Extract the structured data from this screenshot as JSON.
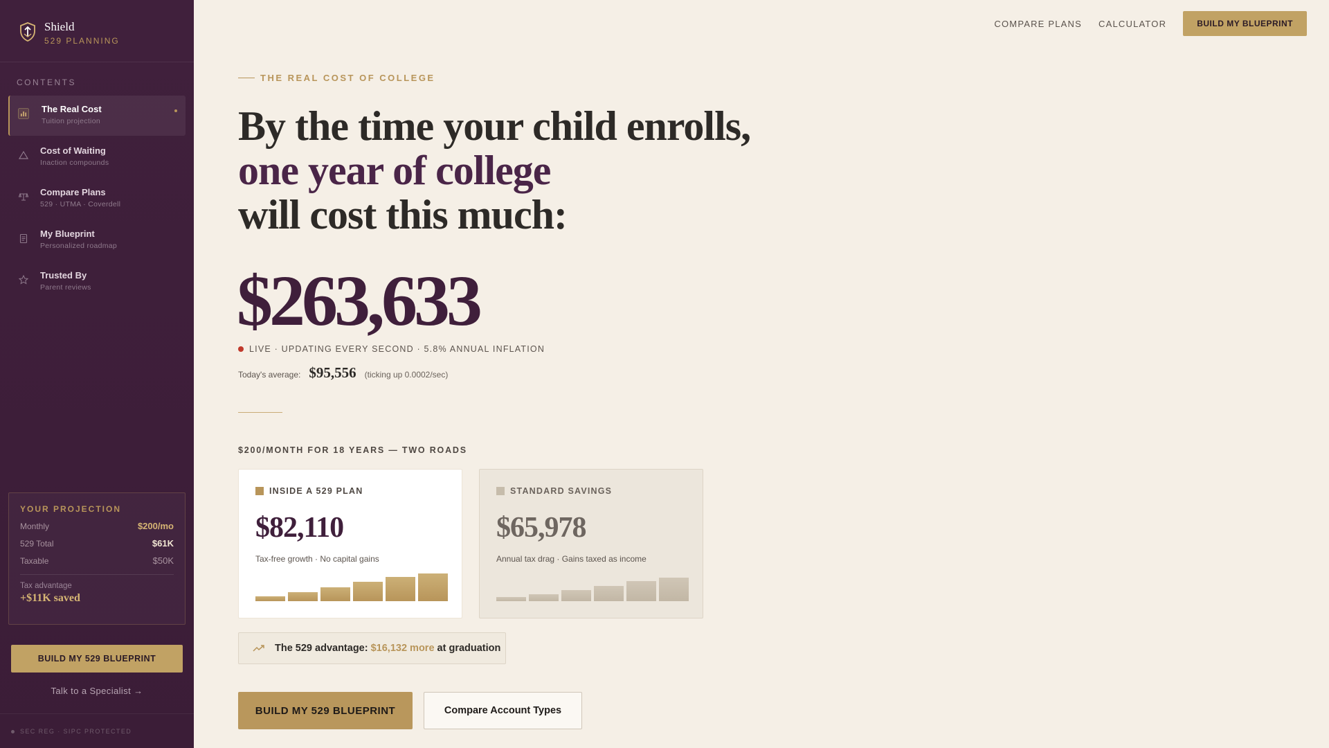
{
  "brand": {
    "name": "Shield",
    "subtitle": "529 PLANNING",
    "icon": "shield-icon"
  },
  "sidebar": {
    "contents_label": "CONTENTS",
    "items": [
      {
        "title": "The Real Cost",
        "subtitle": "Tuition projection",
        "icon": "bar-chart-icon",
        "active": true
      },
      {
        "title": "Cost of Waiting",
        "subtitle": "Inaction compounds",
        "icon": "warning-icon",
        "active": false
      },
      {
        "title": "Compare Plans",
        "subtitle": "529 · UTMA · Coverdell",
        "icon": "scale-icon",
        "active": false
      },
      {
        "title": "My Blueprint",
        "subtitle": "Personalized roadmap",
        "icon": "clipboard-icon",
        "active": false
      },
      {
        "title": "Trusted By",
        "subtitle": "Parent reviews",
        "icon": "star-icon",
        "active": false
      }
    ],
    "projection": {
      "title": "YOUR PROJECTION",
      "rows": [
        {
          "label": "Monthly",
          "value": "$200/mo"
        },
        {
          "label": "529 Total",
          "value": "$61K"
        },
        {
          "label": "Taxable",
          "value": "$50K"
        }
      ],
      "advantage_label": "Tax advantage",
      "advantage_value": "+$11K saved"
    },
    "cta_label": "BUILD MY 529 BLUEPRINT",
    "specialist_link": "Talk to a Specialist →",
    "footer": "SEC REG · SIPC PROTECTED"
  },
  "topnav": {
    "links": [
      "COMPARE PLANS",
      "CALCULATOR"
    ],
    "cta_label": "BUILD MY BLUEPRINT"
  },
  "hero": {
    "eyebrow": "THE REAL COST OF COLLEGE",
    "headline_line1": "By the time your child enrolls,",
    "headline_line2": "one year of college",
    "headline_line3": "will cost this much:",
    "cost": "$263,633",
    "live_text": "LIVE · UPDATING EVERY SECOND · 5.8% ANNUAL INFLATION",
    "avg_label": "Today's average:",
    "avg_value": "$95,556",
    "avg_note": "(ticking up 0.0002/sec)"
  },
  "comparison": {
    "label": "$200/MONTH FOR 18 YEARS — TWO ROADS",
    "plan": {
      "label": "INSIDE A 529 PLAN",
      "value": "$82,110",
      "note": "Tax-free growth · No capital gains",
      "bar_levels": [
        0.18,
        0.32,
        0.5,
        0.7,
        0.88,
        1.0
      ],
      "color": "#b8955a"
    },
    "standard": {
      "label": "STANDARD SAVINGS",
      "value": "$65,978",
      "note": "Annual tax drag · Gains taxed as income",
      "bar_levels": [
        0.15,
        0.26,
        0.4,
        0.56,
        0.72,
        0.85
      ],
      "color": "#c6bcab"
    },
    "advantage_prefix": "The 529 advantage:",
    "advantage_amount": "$16,132 more",
    "advantage_suffix": "at graduation"
  },
  "actions": {
    "primary_label": "BUILD MY 529 BLUEPRINT",
    "secondary_label": "Compare Account Types"
  },
  "colors": {
    "sidebar_bg": "#3e1f3a",
    "accent_gold": "#b8955a",
    "page_bg": "#f5efe6",
    "live_red": "#c0392b"
  }
}
